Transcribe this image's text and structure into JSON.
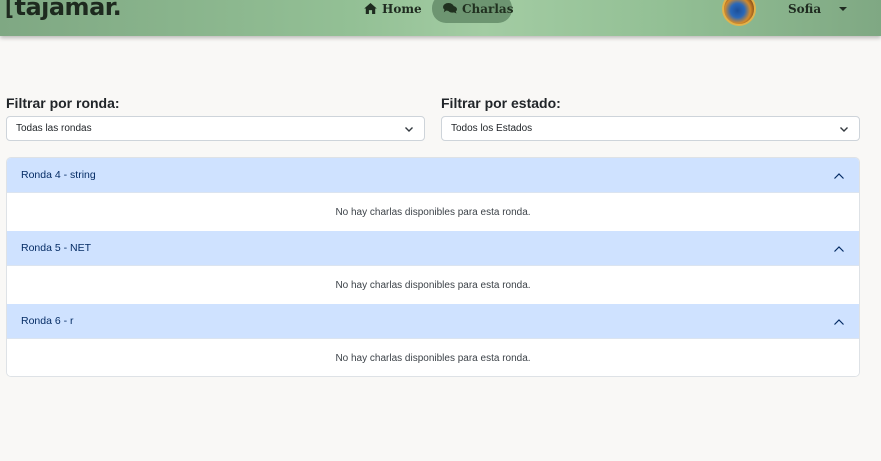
{
  "navbar": {
    "brand": "tajamar.",
    "brand_bracket": "[",
    "home_label": "Home",
    "charlas_label": "Charlas",
    "user_name": "Sofia"
  },
  "filters": {
    "ronda_label": "Filtrar por ronda:",
    "ronda_selected": "Todas las rondas",
    "estado_label": "Filtrar por estado:",
    "estado_selected": "Todos los Estados"
  },
  "rondas": [
    {
      "title": "Ronda 4 - string",
      "empty_message": "No hay charlas disponibles para esta ronda."
    },
    {
      "title": "Ronda 5 - NET",
      "empty_message": "No hay charlas disponibles para esta ronda."
    },
    {
      "title": "Ronda 6 - r",
      "empty_message": "No hay charlas disponibles para esta ronda."
    }
  ],
  "colors": {
    "navbar_green": "#93c095",
    "active_pill": "#6d9571",
    "accordion_header": "#cfe2ff",
    "accordion_text": "#052c65"
  },
  "icons": {
    "home": "home-icon",
    "charlas": "comments-icon",
    "select": "chevron-down-icon",
    "accordion": "chevron-up-icon"
  }
}
